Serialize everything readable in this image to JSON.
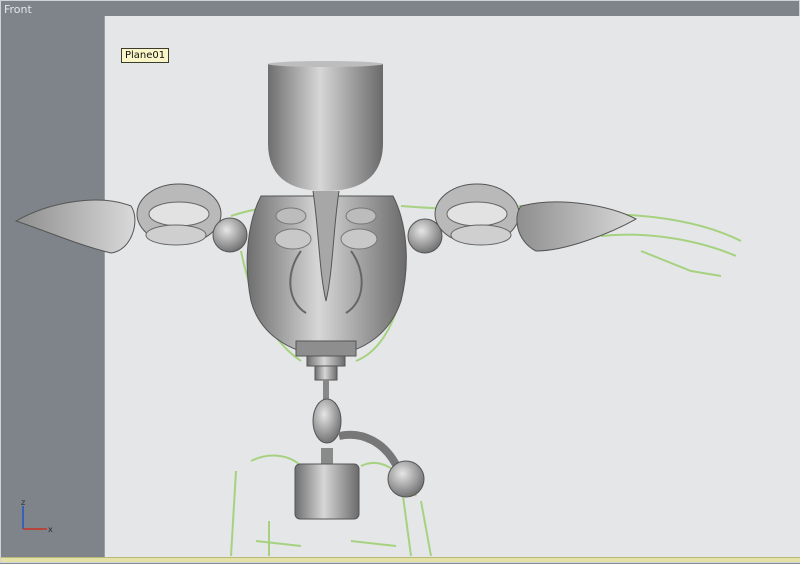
{
  "viewport": {
    "label": "Front",
    "object_tooltip": "Plane01"
  },
  "axis_gizmo": {
    "z_label": "z",
    "x_label": "x",
    "z_color": "#2255c8",
    "x_color": "#c83222"
  },
  "colors": {
    "viewport_bg": "#7e848a",
    "plane_bg": "#e4e6e8",
    "sketch_green": "#86c84a",
    "mesh_gray": "#a9a9a9"
  }
}
